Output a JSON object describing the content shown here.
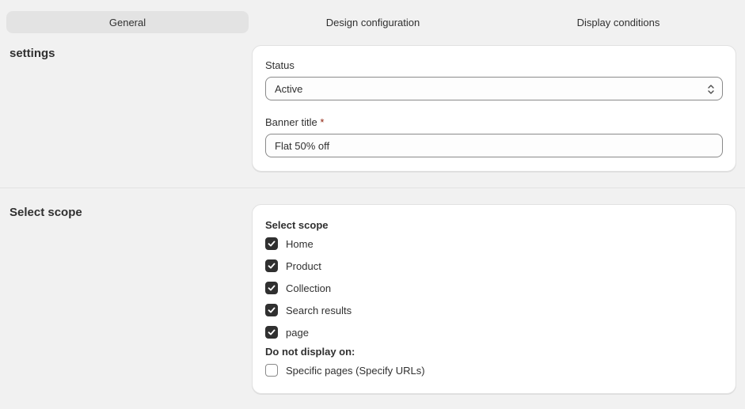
{
  "tabs": [
    {
      "label": "General",
      "active": true
    },
    {
      "label": "Design configuration",
      "active": false
    },
    {
      "label": "Display conditions",
      "active": false
    }
  ],
  "settings": {
    "section_title": "settings",
    "status": {
      "label": "Status",
      "value": "Active"
    },
    "banner_title": {
      "label": "Banner title",
      "required_marker": "*",
      "value": "Flat 50% off"
    }
  },
  "scope": {
    "section_title": "Select scope",
    "group_title": "Select scope",
    "options": [
      {
        "label": "Home",
        "checked": true
      },
      {
        "label": "Product",
        "checked": true
      },
      {
        "label": "Collection",
        "checked": true
      },
      {
        "label": "Search results",
        "checked": true
      },
      {
        "label": "page",
        "checked": true
      }
    ],
    "exclude_title": "Do not display on:",
    "exclude_options": [
      {
        "label": "Specific pages (Specify URLs)",
        "checked": false
      }
    ]
  },
  "icons": {
    "checkmark": "checkmark-icon",
    "select_arrows": "select-chevron-icon"
  },
  "colors": {
    "checkbox_on": "#303030",
    "required": "#8e1f0b",
    "tab_active": "#e3e3e3"
  }
}
